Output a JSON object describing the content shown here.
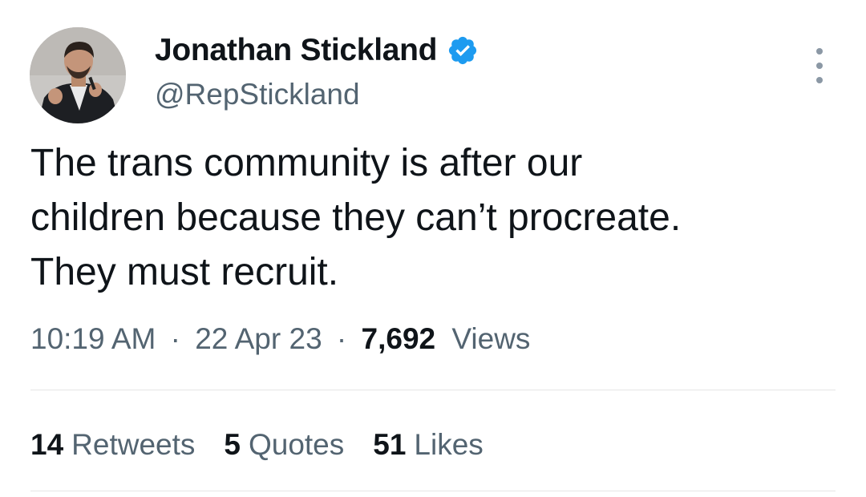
{
  "author": {
    "display_name": "Jonathan Stickland",
    "handle": "@RepStickland",
    "verified": true
  },
  "tweet": {
    "lines": [
      "The trans community is after our",
      "children because they can’t procreate.",
      "They must recruit."
    ]
  },
  "meta": {
    "time": "10:19 AM",
    "separator": "·",
    "date": "22 Apr 23",
    "views_count": "7,692",
    "views_label": "Views"
  },
  "stats": {
    "retweets_count": "14",
    "retweets_label": "Retweets",
    "quotes_count": "5",
    "quotes_label": "Quotes",
    "likes_count": "51",
    "likes_label": "Likes"
  },
  "colors": {
    "primary_text": "#0f1419",
    "secondary_text": "#536471",
    "verified_blue": "#1d9bf0",
    "divider": "#e6e6e6"
  },
  "icons": {
    "verified": "verified-badge-icon",
    "more": "more-options-icon"
  }
}
